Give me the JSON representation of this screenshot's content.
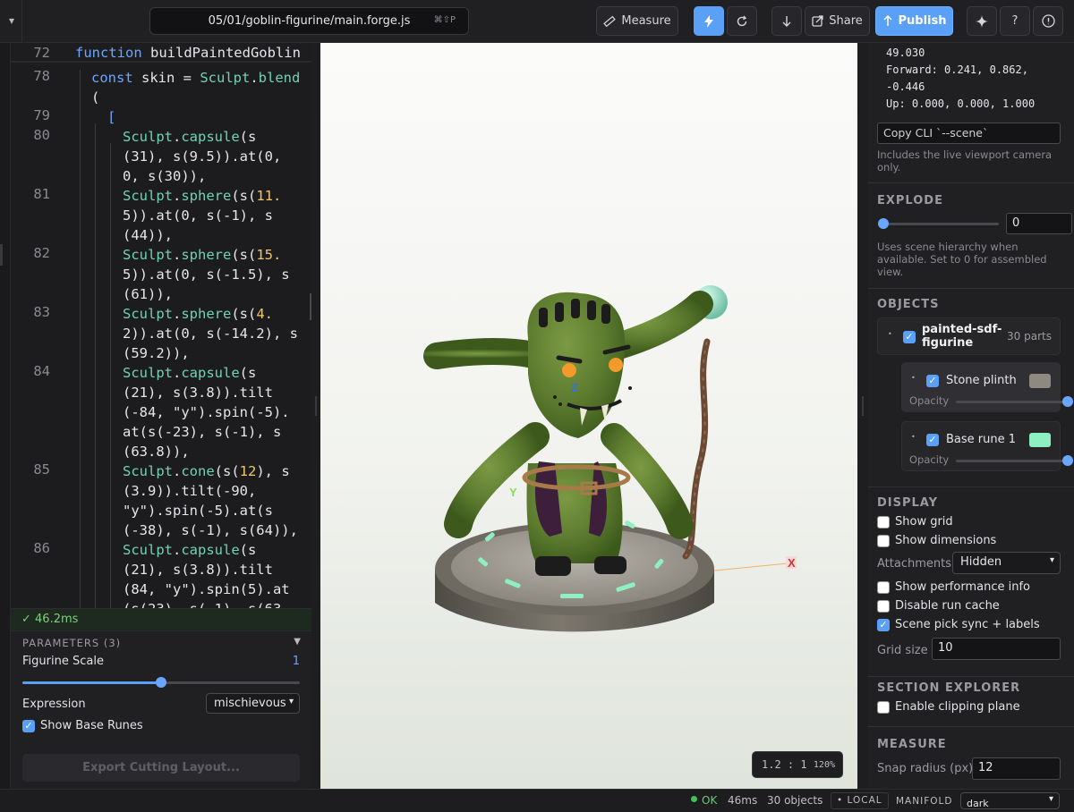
{
  "toolbar": {
    "file_path": "05/01/goblin-figurine/main.forge.js",
    "shortcut": "⌘⇧P",
    "measure_label": "Measure",
    "share_label": "Share",
    "publish_label": "Publish",
    "help_label": "?"
  },
  "editor": {
    "sticky": {
      "line": "72",
      "keyword": "function",
      "name": " buildPaintedGoblin"
    },
    "lines": [
      {
        "n": "78",
        "text": "const skin = Sculpt.blend"
      },
      {
        "n": "79",
        "text": "["
      },
      {
        "n": "80",
        "text": "Sculpt.capsule(s"
      },
      {
        "n": "81",
        "text": "Sculpt.sphere(s(11."
      },
      {
        "n": "82",
        "text": "Sculpt.sphere(s(15."
      },
      {
        "n": "83",
        "text": "Sculpt.sphere(s(4."
      },
      {
        "n": "84",
        "text": "Sculpt.capsule(s"
      },
      {
        "n": "85",
        "text": "Sculpt.cone(s(12), s"
      },
      {
        "n": "86",
        "text": "Sculpt.capsule(s"
      }
    ],
    "raw": {
      "l78b": "(",
      "l80a": "(31), s(9.5)).at(0,",
      "l80b": "0, s(30)),",
      "l81a": "5)).at(0, s(-1), s",
      "l81b": "(44)),",
      "l82a": "5)).at(0, s(-1.5), s",
      "l82b": "(61)),",
      "l83a": "2)).at(0, s(-14.2), s",
      "l83b": "(59.2)),",
      "l84a": "(21), s(3.8)).tilt",
      "l84b": "(-84, \"y\").spin(-5).",
      "l84c": "at(s(-23), s(-1), s",
      "l84d": "(63.8)),",
      "l85a": "(3.9)).tilt(-90,",
      "l85b": "\"y\").spin(-5).at(s",
      "l85c": "(-38), s(-1), s(64)),",
      "l86a": "(21), s(3.8)).tilt",
      "l86b": "(84, \"y\").spin(5).at",
      "l86c": "(s(23), s(-1), s(63"
    }
  },
  "timer": "✓ 46.2ms",
  "parameters": {
    "header": "PARAMETERS (3)",
    "scale_label": "Figurine Scale",
    "scale_value": "1",
    "scale_fraction": 0.5,
    "expression_label": "Expression",
    "expression_value": "mischievous",
    "runes_label": "Show Base Runes",
    "runes_checked": true,
    "export_label": "Export Cutting Layout..."
  },
  "viewport": {
    "axis_x": "X",
    "axis_y": "Y",
    "axis_z": "Z",
    "zoom_ratio": "1.2 : 1",
    "zoom_pct": "120%",
    "colors": {
      "skin": "#5b7a2e",
      "plinth": "#6e6a62",
      "rune": "#8ef0c0",
      "orb": "#8fd8c0",
      "staff": "#6b4a35"
    }
  },
  "camera": {
    "line0": "49.030",
    "line1": "Forward: 0.241, 0.862,",
    "line2": "-0.446",
    "line3": "Up: 0.000, 0.000, 1.000",
    "copy_label": "Copy CLI `--scene`",
    "copy_note_1": "Includes the live viewport camera",
    "copy_note_2": "only."
  },
  "explode": {
    "header": "EXPLODE",
    "value": "0",
    "note_1": "Uses scene hierarchy when",
    "note_2": "available. Set to 0 for assembled",
    "note_3": "view."
  },
  "objects": {
    "header": "OBJECTS",
    "root_name_1": "painted-sdf-",
    "root_name_2": "figurine",
    "root_count": "30 parts",
    "opacity_label": "Opacity",
    "items": [
      {
        "name": "Stone plinth",
        "color": "#8f8a80"
      },
      {
        "name": "Base rune 1",
        "color": "#8ef0c0"
      }
    ]
  },
  "display": {
    "header": "DISPLAY",
    "show_grid": "Show grid",
    "show_dimensions": "Show dimensions",
    "attachments_label": "Attachments",
    "attachments_value": "Hidden",
    "show_perf": "Show performance info",
    "disable_cache": "Disable run cache",
    "scene_pick": "Scene pick sync + labels",
    "grid_size_label": "Grid size",
    "grid_size_value": "10"
  },
  "section": {
    "header": "SECTION EXPLORER",
    "clipping": "Enable clipping plane"
  },
  "measure": {
    "header": "MEASURE",
    "snap_label": "Snap radius (px)",
    "snap_value": "12"
  },
  "status": {
    "ok": "OK",
    "time": "46ms",
    "objects": "30 objects",
    "local": "• LOCAL",
    "manifold": "MANIFOLD",
    "theme": "dark"
  }
}
